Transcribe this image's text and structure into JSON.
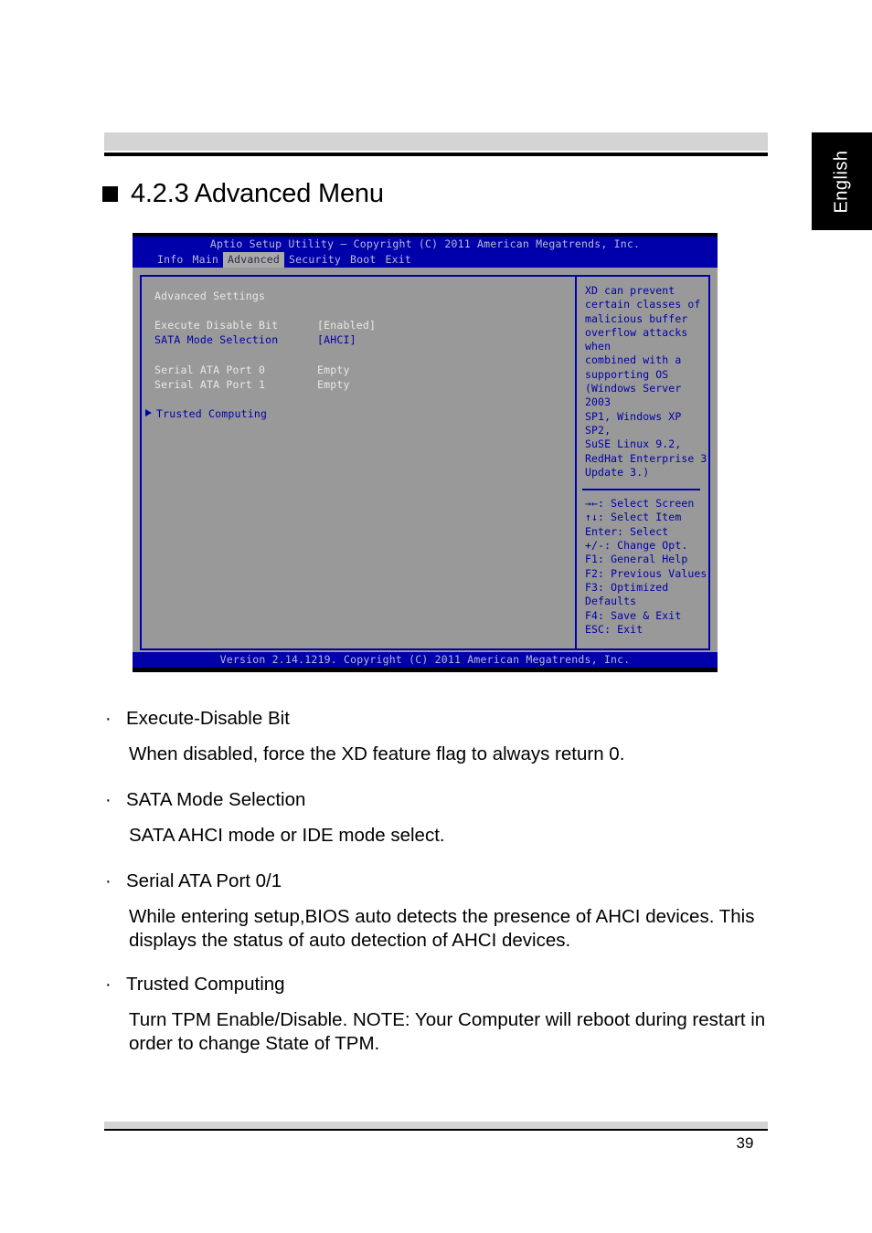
{
  "page": {
    "language_tab": "English",
    "heading": "4.2.3 Advanced Menu",
    "page_number": "39"
  },
  "bios": {
    "title": "Aptio Setup Utility – Copyright (C) 2011 American Megatrends, Inc.",
    "menu_tabs": [
      {
        "label": "Info",
        "active": false
      },
      {
        "label": "Main",
        "active": false
      },
      {
        "label": "Advanced",
        "active": true
      },
      {
        "label": "Security",
        "active": false
      },
      {
        "label": "Boot",
        "active": false
      },
      {
        "label": "Exit",
        "active": false
      }
    ],
    "settings": {
      "section_title": "Advanced Settings",
      "items": [
        {
          "label": "Execute Disable Bit",
          "value": "[Enabled]",
          "color": "white"
        },
        {
          "label": "SATA Mode Selection",
          "value": "[AHCI]",
          "color": "blue"
        },
        {
          "label": "Serial ATA Port 0",
          "value": "Empty",
          "color": "white"
        },
        {
          "label": "Serial ATA Port 1",
          "value": "Empty",
          "color": "white"
        }
      ],
      "submenu": "Trusted Computing"
    },
    "help": {
      "lines": [
        "XD can prevent",
        "certain classes of",
        "malicious buffer",
        "overflow attacks when",
        "combined with a",
        "supporting OS",
        "(Windows Server 2003",
        "SP1, Windows XP SP2,",
        "SuSE Linux 9.2,",
        "RedHat Enterprise 3",
        "Update 3.)"
      ]
    },
    "keys": [
      "→←: Select Screen",
      "↑↓: Select Item",
      "Enter: Select",
      "+/-: Change Opt.",
      "F1: General Help",
      "F2: Previous Values",
      "F3: Optimized Defaults",
      "F4: Save & Exit",
      "ESC: Exit"
    ],
    "footer": "Version 2.14.1219. Copyright (C) 2011 American Megatrends, Inc."
  },
  "content": {
    "bullet_char": "·",
    "items": [
      {
        "title": "Execute-Disable Bit",
        "body": "When disabled, force the XD feature flag to always return 0."
      },
      {
        "title": "SATA Mode Selection",
        "body": "SATA AHCI mode or IDE mode select."
      },
      {
        "title": "Serial ATA Port 0/1",
        "body": "While entering setup,BIOS auto detects the presence of AHCI devices. This displays the status of auto detection of AHCI devices."
      },
      {
        "title": "Trusted Computing",
        "body": "Turn TPM Enable/Disable. NOTE: Your Computer will reboot during restart in order to change State of TPM."
      }
    ]
  },
  "colors": {
    "bios_blue": "#0000AA",
    "bios_grey": "#999999",
    "rule_grey": "#D4D4D4"
  }
}
